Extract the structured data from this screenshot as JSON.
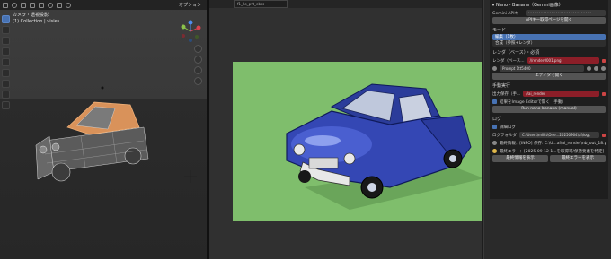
{
  "viewport": {
    "options_label": "オプション",
    "info_line1": "カメラ・透視投影",
    "info_line2": "(1) Collection | visies"
  },
  "image_editor": {
    "tab_label": "f1_hs_pvt_ebss"
  },
  "panel": {
    "title": "Nano - Banana（Gemini画像）",
    "api_label": "Gemini APIキー",
    "api_value": "••••••••••••••••••••••••••••••",
    "api_button": "APIキー取得ページを開く",
    "mode_section": "モード",
    "mode_items": [
      "編集（1枚）",
      "合成（参照+レンダ）"
    ],
    "render_section": "レンダ（ベース）・必須",
    "render_label": "レンダ（ベース...",
    "render_value": "//render0001.png",
    "prompt_value": "Prompt 1tt5400",
    "editor_button": "エディタで開く",
    "save_section": "手動実行",
    "output_label": "出力保存（手...",
    "output_value": "//ai_render",
    "result_check": "結果をImage Editorで開く（手動）",
    "run_button": "Run nano-banana (manual)",
    "log_section": "ログ",
    "log_check": "詳細ログ",
    "log_folder_label": "ログフォルダ",
    "log_folder_value": "C:\\Users\\milkt\\One...20250904\\ai\\log\\",
    "log_latest": "最終情報：[INFO] 保存: C:\\U...ai\\ai_render\\nb_out_18.png",
    "log_error": "最終エラー：[2025-09-12 1...を取得可/保持要素を特定]",
    "btn_open_log": "最終情報を表示",
    "btn_open_error": "最終エラーを表示"
  }
}
